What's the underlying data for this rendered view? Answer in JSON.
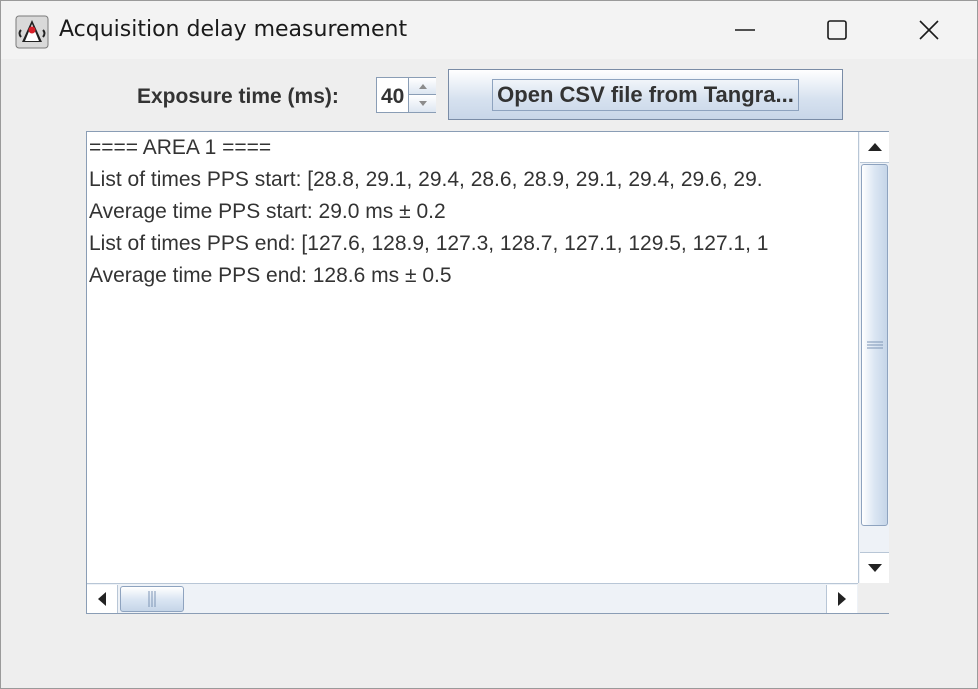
{
  "window": {
    "title": "Acquisition delay measurement",
    "app_icon": "java-duke-icon",
    "controls": [
      "minimize-icon",
      "maximize-icon",
      "close-icon"
    ]
  },
  "toolbar": {
    "exposure_label": "Exposure time (ms):",
    "exposure_value": "40",
    "open_button_label": "Open CSV file from Tangra..."
  },
  "output": {
    "lines": [
      "==== AREA 1 ====",
      "List of times PPS start: [28.8, 29.1, 29.4, 28.6, 28.9, 29.1, 29.4, 29.6, 29.",
      "Average time PPS start: 29.0 ms ± 0.2",
      "List of times PPS end: [127.6, 128.9, 127.3, 128.7, 127.1, 129.5, 127.1, 1",
      "Average time PPS end: 128.6 ms ± 0.5"
    ]
  },
  "colors": {
    "window_bg": "#eeeeee",
    "accent_border": "#8a9db5",
    "text": "#333333"
  }
}
